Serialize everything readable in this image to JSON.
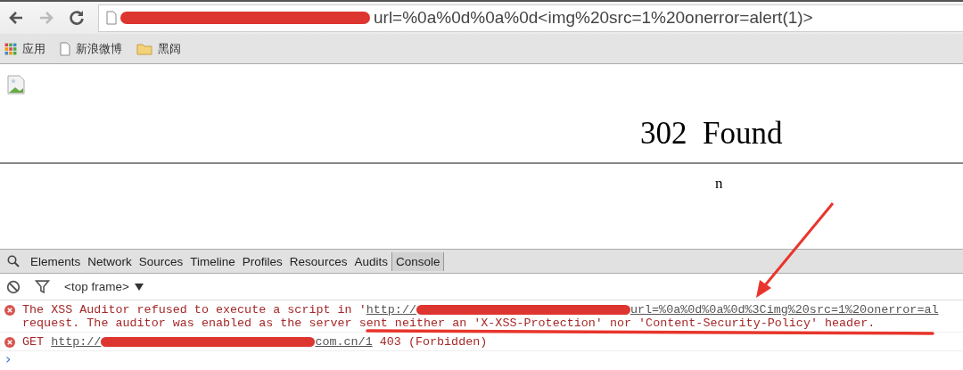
{
  "nav_buttons": [
    {
      "kind": "back",
      "disabled": false
    },
    {
      "kind": "forward",
      "disabled": true
    },
    {
      "kind": "reload",
      "disabled": false
    }
  ],
  "address": {
    "redacted": true,
    "value": "url=%0a%0d%0a%0d<img%20src=1%20onerror=alert(1)>"
  },
  "bookmarks": [
    {
      "kind": "apps",
      "label": "应用"
    },
    {
      "kind": "page",
      "label": "新浪微博"
    },
    {
      "kind": "folder",
      "label": "黑阔"
    }
  ],
  "page": {
    "broken_image": true,
    "heading": "302  Found",
    "body": "n"
  },
  "devtools": {
    "tabs": [
      {
        "label": "Elements",
        "selected": false
      },
      {
        "label": "Network",
        "selected": false
      },
      {
        "label": "Sources",
        "selected": false
      },
      {
        "label": "Timeline",
        "selected": false
      },
      {
        "label": "Profiles",
        "selected": false
      },
      {
        "label": "Resources",
        "selected": false
      },
      {
        "label": "Audits",
        "selected": false
      },
      {
        "label": "Console",
        "selected": true
      }
    ],
    "frame_selector": "<top frame>",
    "messages": [
      {
        "lines": [
          [
            {
              "kind": "text",
              "text": "The XSS Auditor refused to execute a script in '"
            },
            {
              "kind": "link",
              "before": "http://",
              "after": "url=%0a%0d%0a%0d%3Cimg%20src=1%20onerror=al"
            }
          ],
          [
            {
              "kind": "text",
              "text": "request. The auditor was enabled as the server sent neither an 'X-XSS-Protection' nor 'Content-Security-Policy' header."
            }
          ]
        ]
      },
      {
        "lines": [
          [
            {
              "kind": "text",
              "text": "GET "
            },
            {
              "kind": "link",
              "before": "http://",
              "after": "com.cn/1"
            },
            {
              "kind": "text",
              "text": " 403 (Forbidden)"
            }
          ]
        ]
      }
    ],
    "prompt": "›"
  }
}
